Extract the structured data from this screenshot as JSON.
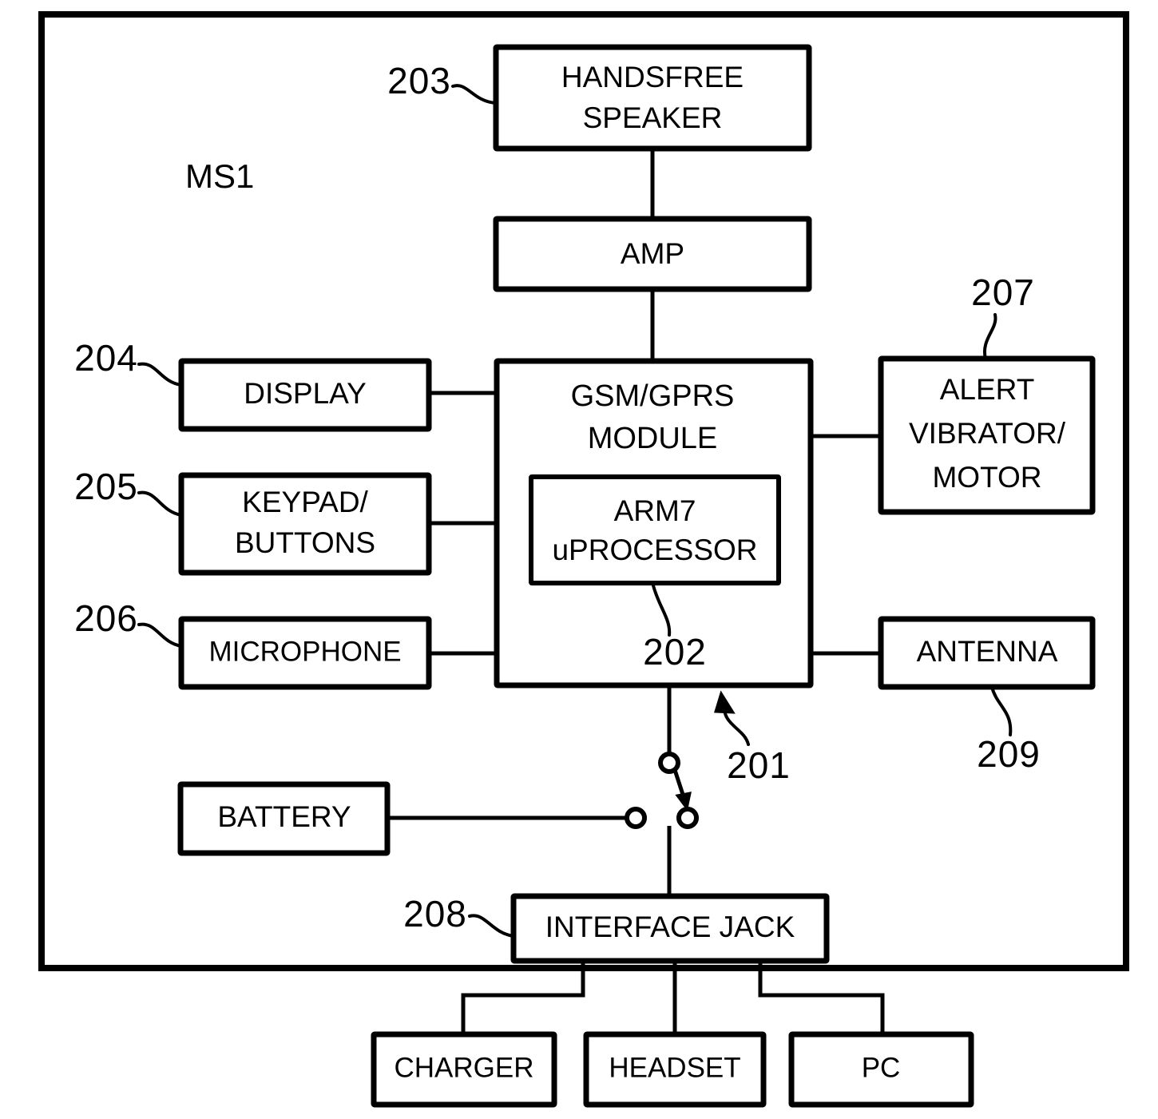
{
  "figure": {
    "system_label": "MS1",
    "enclosure_name": "mobile-station-enclosure"
  },
  "blocks": {
    "handsfree_speaker": {
      "line1": "HANDSFREE",
      "line2": "SPEAKER"
    },
    "amp": {
      "line1": "AMP"
    },
    "gsm_module": {
      "line1": "GSM/GPRS",
      "line2": "MODULE"
    },
    "processor": {
      "line1": "ARM7",
      "line2": "uPROCESSOR"
    },
    "display": {
      "line1": "DISPLAY"
    },
    "keypad": {
      "line1": "KEYPAD/",
      "line2": "BUTTONS"
    },
    "microphone": {
      "line1": "MICROPHONE"
    },
    "alert_vibrator": {
      "line1": "ALERT",
      "line2": "VIBRATOR/",
      "line3": "MOTOR"
    },
    "antenna": {
      "line1": "ANTENNA"
    },
    "battery": {
      "line1": "BATTERY"
    },
    "interface_jack": {
      "line1": "INTERFACE JACK"
    },
    "charger": {
      "line1": "CHARGER"
    },
    "headset": {
      "line1": "HEADSET"
    },
    "pc": {
      "line1": "PC"
    }
  },
  "reference_numerals": {
    "handsfree_speaker": "203",
    "gsm_module": "201",
    "processor": "202",
    "display": "204",
    "keypad": "205",
    "microphone": "206",
    "alert_vibrator": "207",
    "interface_jack": "208",
    "antenna": "209"
  },
  "colors": {
    "line": "#000000",
    "fill": "#ffffff"
  }
}
